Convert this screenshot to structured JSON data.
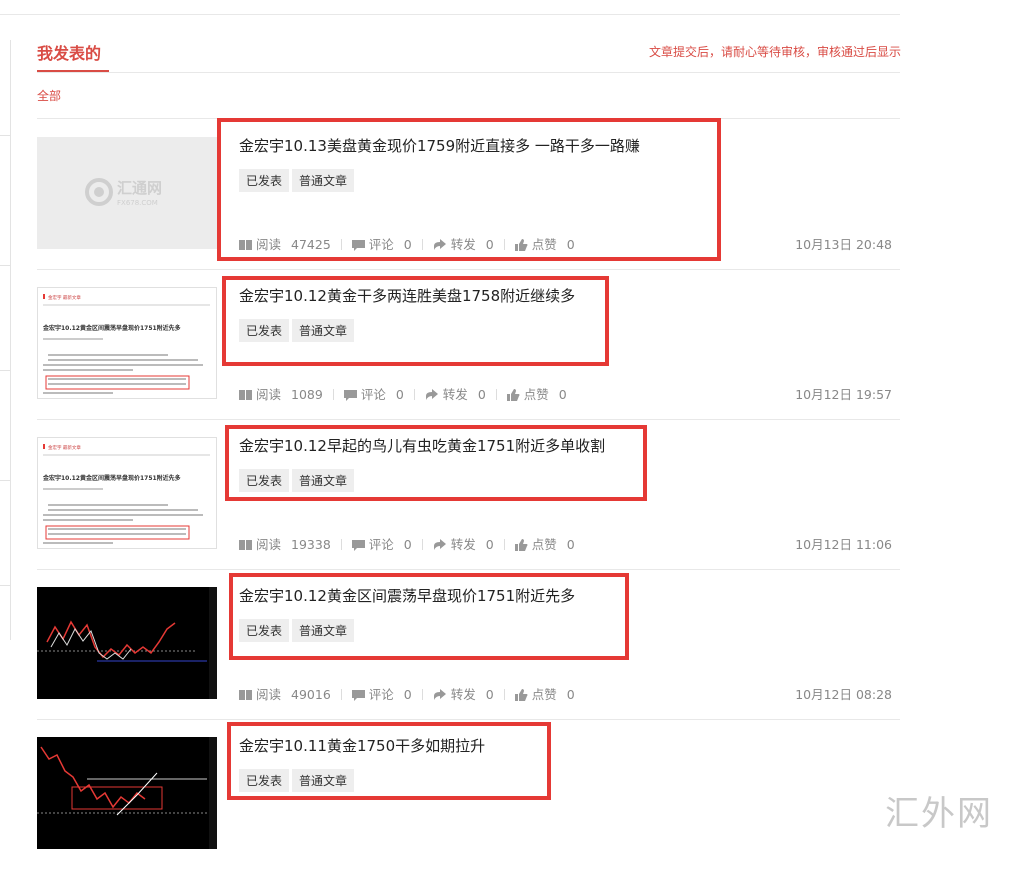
{
  "header": {
    "tab_title": "我发表的",
    "notice": "文章提交后，请耐心等待审核，审核通过后显示",
    "filter_all": "全部"
  },
  "placeholder_logo": {
    "brand": "汇通网",
    "domain": "FX678.COM"
  },
  "doc_thumb_text": {
    "header_tag": "金宏宇 最新文章",
    "title": "金宏宇10.12黄金区间震荡早盘现价1751附近先多"
  },
  "articles": [
    {
      "title": "金宏宇10.13美盘黄金现价1759附近直接多 一路干多一路赚",
      "tags": [
        "已发表",
        "普通文章"
      ],
      "stats": {
        "read_label": "阅读",
        "read": "47425",
        "comment_label": "评论",
        "comment": "0",
        "share_label": "转发",
        "share": "0",
        "like_label": "点赞",
        "like": "0"
      },
      "time": "10月13日 20:48",
      "thumb": "placeholder"
    },
    {
      "title": "金宏宇10.12黄金干多两连胜美盘1758附近继续多",
      "tags": [
        "已发表",
        "普通文章"
      ],
      "stats": {
        "read_label": "阅读",
        "read": "1089",
        "comment_label": "评论",
        "comment": "0",
        "share_label": "转发",
        "share": "0",
        "like_label": "点赞",
        "like": "0"
      },
      "time": "10月12日 19:57",
      "thumb": "document"
    },
    {
      "title": "金宏宇10.12早起的鸟儿有虫吃黄金1751附近多单收割",
      "tags": [
        "已发表",
        "普通文章"
      ],
      "stats": {
        "read_label": "阅读",
        "read": "19338",
        "comment_label": "评论",
        "comment": "0",
        "share_label": "转发",
        "share": "0",
        "like_label": "点赞",
        "like": "0"
      },
      "time": "10月12日 11:06",
      "thumb": "document"
    },
    {
      "title": "金宏宇10.12黄金区间震荡早盘现价1751附近先多",
      "tags": [
        "已发表",
        "普通文章"
      ],
      "stats": {
        "read_label": "阅读",
        "read": "49016",
        "comment_label": "评论",
        "comment": "0",
        "share_label": "转发",
        "share": "0",
        "like_label": "点赞",
        "like": "0"
      },
      "time": "10月12日 08:28",
      "thumb": "kline"
    },
    {
      "title": "金宏宇10.11黄金1750干多如期拉升",
      "tags": [
        "已发表",
        "普通文章"
      ],
      "stats": {
        "read_label": "阅读",
        "read": "",
        "comment_label": "评论",
        "comment": "",
        "share_label": "转发",
        "share": "",
        "like_label": "点赞",
        "like": ""
      },
      "time": "",
      "thumb": "kline"
    }
  ],
  "watermark": "汇外网",
  "colors": {
    "accent": "#d94c45",
    "highlight": "#e53935"
  }
}
